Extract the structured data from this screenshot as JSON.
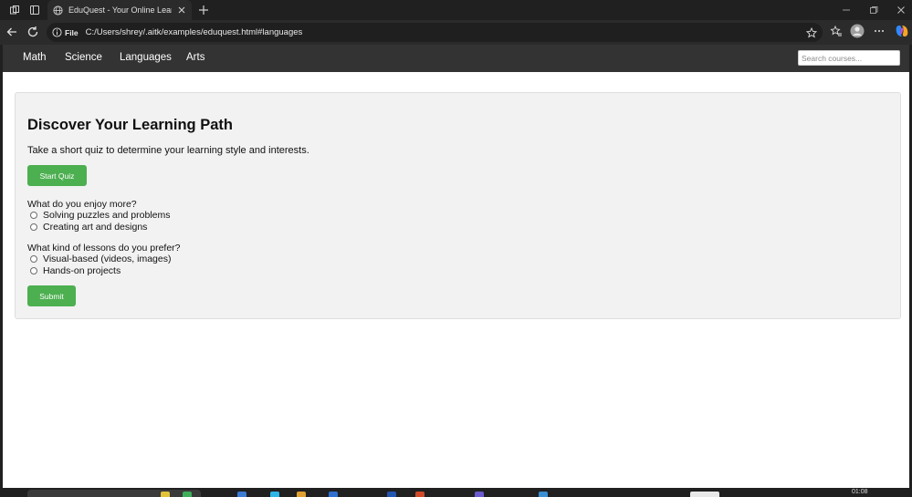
{
  "browser": {
    "tab_title": "EduQuest - Your Online Learning",
    "address_scheme": "File",
    "address_url": "C:/Users/shrey/.aitk/examples/eduquest.html#languages"
  },
  "site_nav": {
    "links": [
      "Math",
      "Science",
      "Languages",
      "Arts"
    ],
    "search_placeholder": "Search courses..."
  },
  "hero": {
    "title": "Discover Your Learning Path",
    "intro": "Take a short quiz to determine your learning style and interests.",
    "start_button": "Start Quiz"
  },
  "quiz": {
    "questions": [
      {
        "label": "What do you enjoy more?",
        "options": [
          "Solving puzzles and problems",
          "Creating art and designs"
        ]
      },
      {
        "label": "What kind of lessons do you prefer?",
        "options": [
          "Visual-based (videos, images)",
          "Hands-on projects"
        ]
      }
    ],
    "submit_button": "Submit"
  },
  "taskbar": {
    "clock": "01:08"
  },
  "colors": {
    "nav_bg": "#333333",
    "button_green": "#4caf50",
    "card_bg": "#f2f2f2"
  }
}
